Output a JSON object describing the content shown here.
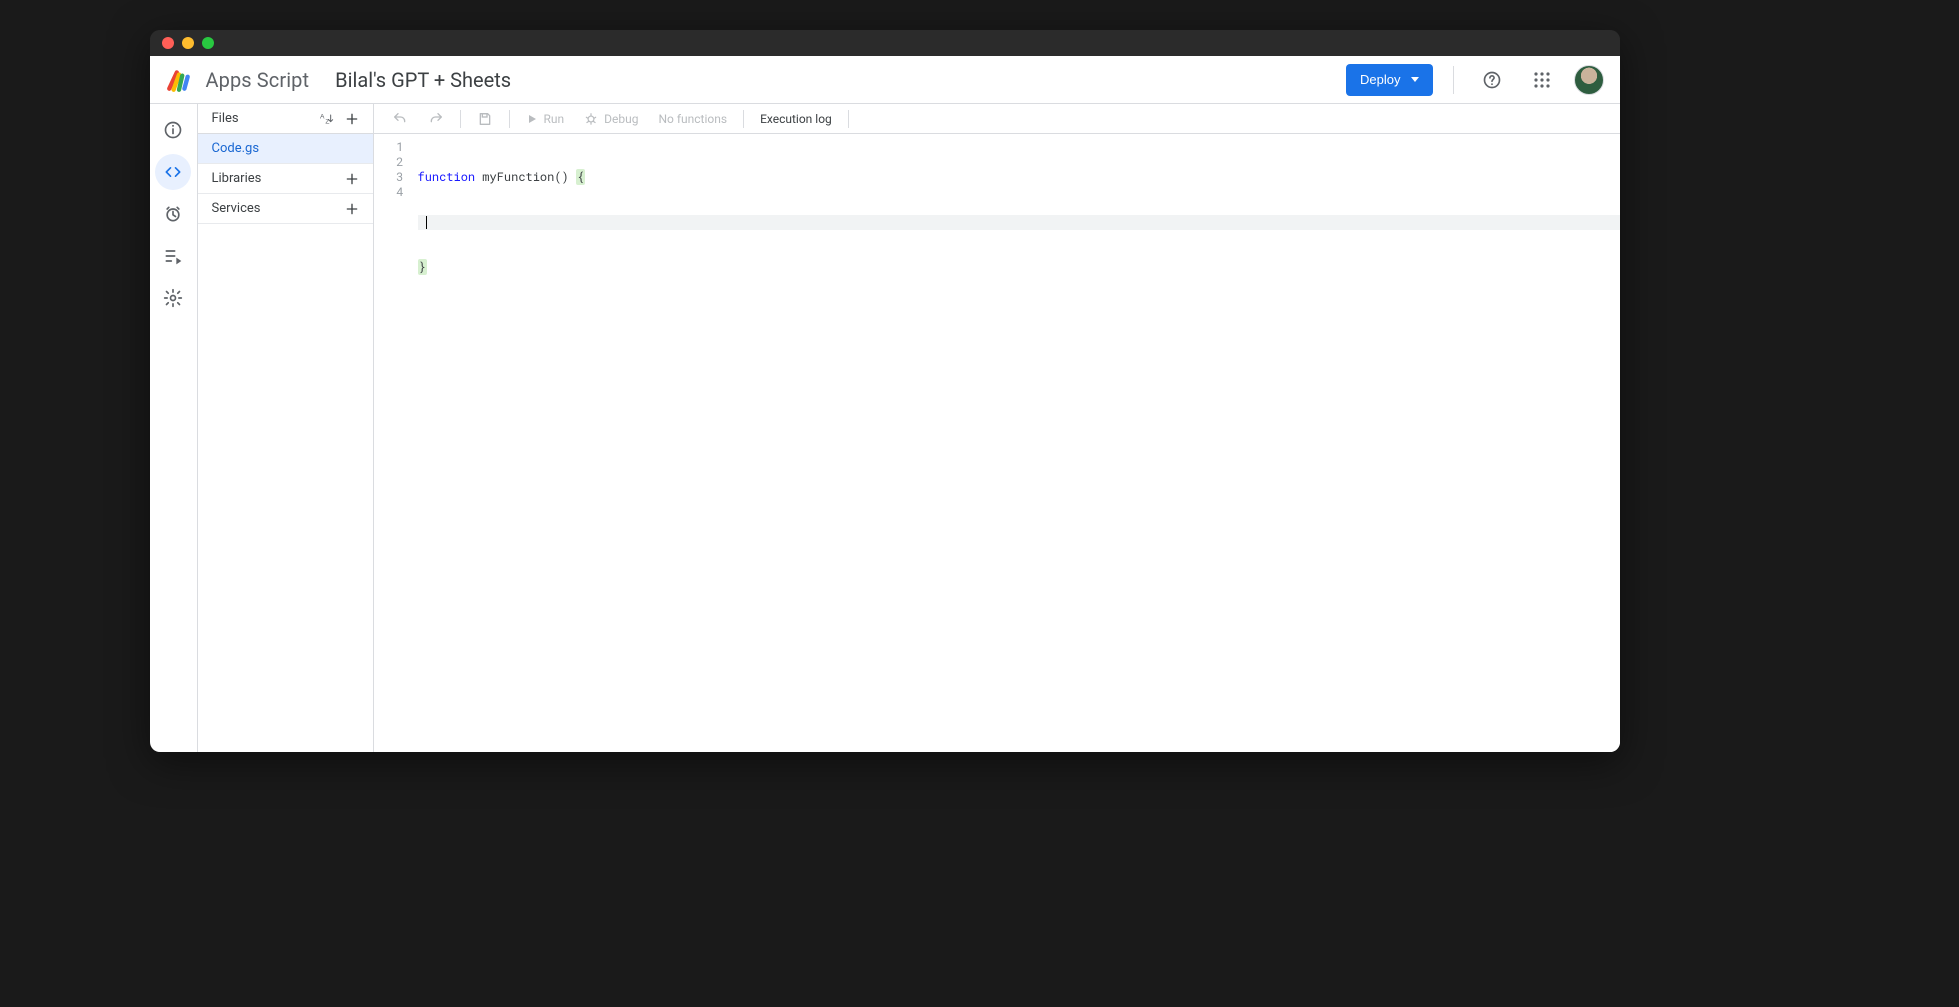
{
  "header": {
    "product_name": "Apps Script",
    "project_title": "Bilal's GPT + Sheets",
    "deploy_label": "Deploy"
  },
  "files_panel": {
    "header_label": "Files",
    "file_name": "Code.gs",
    "libraries_label": "Libraries",
    "services_label": "Services"
  },
  "editor_toolbar": {
    "run_label": "Run",
    "debug_label": "Debug",
    "functions_label": "No functions",
    "execution_log_label": "Execution log"
  },
  "code": {
    "line_numbers": [
      "1",
      "2",
      "3",
      "4"
    ],
    "kw1": "function",
    "fn_name": " myFunction() ",
    "open_brace": "{",
    "close_brace": "}"
  }
}
